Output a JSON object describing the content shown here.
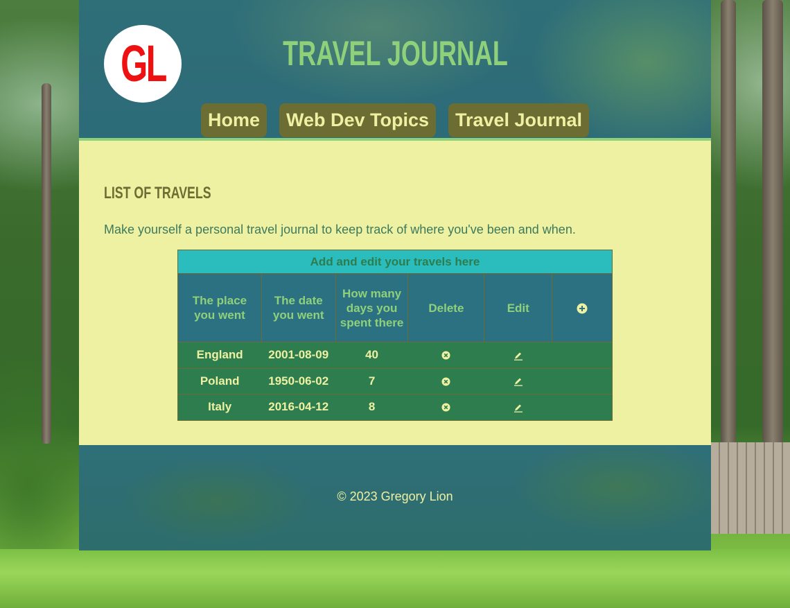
{
  "logo": {
    "text": "GL"
  },
  "header": {
    "title": "TRAVEL JOURNAL"
  },
  "nav": {
    "items": [
      {
        "label": "Home"
      },
      {
        "label": "Web Dev Topics"
      },
      {
        "label": "Travel Journal"
      }
    ]
  },
  "main": {
    "heading": "LIST OF TRAVELS",
    "intro": "Make yourself a personal travel journal to keep track of where you've been and when."
  },
  "table": {
    "caption": "Add and edit your travels here",
    "headers": {
      "place": "The place you went",
      "date": "The date you went",
      "days": "How many days you spent there",
      "delete": "Delete",
      "edit": "Edit",
      "add_icon": "plus-circle-icon"
    },
    "rows": [
      {
        "place": "England",
        "date": "2001-08-09",
        "days": "40",
        "delete_icon": "x-circle-icon",
        "edit_icon": "pencil-icon"
      },
      {
        "place": "Poland",
        "date": "1950-06-02",
        "days": "7",
        "delete_icon": "x-circle-icon",
        "edit_icon": "pencil-icon"
      },
      {
        "place": "Italy",
        "date": "2016-04-12",
        "days": "8",
        "delete_icon": "x-circle-icon",
        "edit_icon": "pencil-icon"
      }
    ]
  },
  "footer": {
    "copyright": "© 2023 Gregory Lion"
  },
  "colors": {
    "header_bg": "#2c6b78",
    "title_green": "#8fd07a",
    "nav_bg": "#6b6d32",
    "nav_text": "#f0f0a2",
    "main_bg": "#eef0a2",
    "caption_bg": "#2bbdbd",
    "row_bg": "#2e7d4f",
    "logo_red": "#ee1111"
  }
}
